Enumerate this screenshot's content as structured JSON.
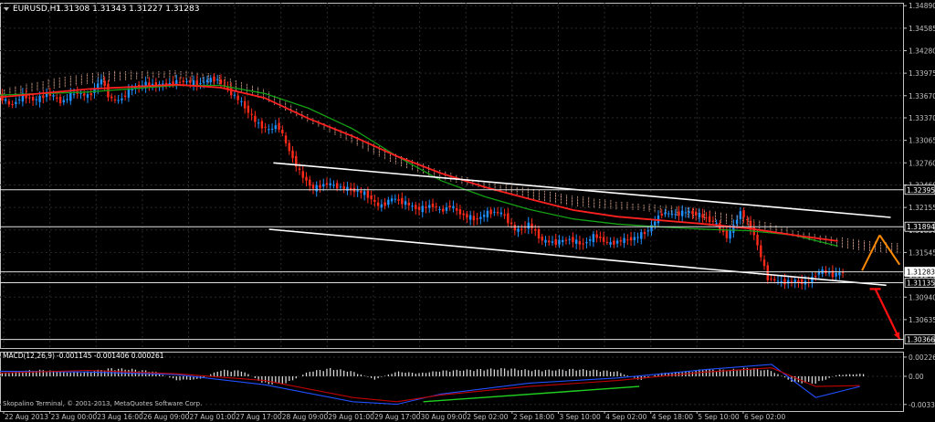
{
  "chart_data": [
    {
      "type": "candlestick",
      "title": "EURUSD,H1  1.31308 1.31343 1.31227 1.31283",
      "symbol_label": "EURUSD,H1",
      "ohlc_label": "1.31308 1.31343 1.31227 1.31283",
      "ohlc": {
        "open": 1.31308,
        "high": 1.31343,
        "low": 1.31227,
        "close": 1.31283
      },
      "ylim": [
        1.3025,
        1.3493
      ],
      "y_ticks": [
        1.3489,
        1.34585,
        1.3428,
        1.33975,
        1.3367,
        1.3337,
        1.33065,
        1.3276,
        1.3246,
        1.32155,
        1.3185,
        1.31545,
        1.3124,
        1.3094,
        1.30635
      ],
      "y_tick_labels": [
        "1.34890",
        "1.34585",
        "1.34280",
        "1.33975",
        "1.33670",
        "1.33370",
        "1.33065",
        "1.32760",
        "1.32460",
        "1.32155",
        "1.31850",
        "1.31545",
        "1.31240",
        "1.30940",
        "1.30635"
      ],
      "x_tick_labels": [
        "22 Aug 2013",
        "23 Aug 00:00",
        "23 Aug 16:00",
        "26 Aug 09:00",
        "27 Aug 01:00",
        "27 Aug 17:00",
        "28 Aug 09:00",
        "29 Aug 01:00",
        "29 Aug 17:00",
        "30 Aug 09:00",
        "2 Sep 02:00",
        "2 Sep 18:00",
        "3 Sep 10:00",
        "4 Sep 02:00",
        "4 Sep 18:00",
        "5 Sep 10:00",
        "6 Sep 02:00"
      ],
      "price_levels": [
        {
          "value": 1.32395,
          "label": "1.32395"
        },
        {
          "value": 1.31894,
          "label": "1.31894"
        },
        {
          "value": 1.31283,
          "label": "1.31283"
        },
        {
          "value": 1.31135,
          "label": "1.31135"
        },
        {
          "value": 1.30366,
          "label": "1.30366"
        }
      ],
      "grid": true,
      "series": [
        {
          "role": "close",
          "x": [
            0,
            5,
            10,
            16,
            22,
            28,
            34,
            40,
            46,
            50,
            54,
            60,
            66,
            72,
            78,
            84,
            90,
            94,
            98,
            104,
            110,
            116,
            122,
            126,
            130,
            136,
            142,
            148,
            154,
            160,
            166,
            172,
            178,
            184,
            190,
            196,
            200,
            204,
            210,
            216,
            222,
            228,
            234,
            240,
            246,
            252,
            258,
            264,
            270,
            276,
            282,
            288,
            294,
            300,
            306,
            312,
            318,
            324,
            330,
            336,
            342,
            348,
            354,
            360,
            366,
            372,
            378,
            383
          ],
          "values": [
            1.3366,
            1.3353,
            1.3367,
            1.3361,
            1.337,
            1.3358,
            1.3372,
            1.3366,
            1.3389,
            1.3362,
            1.336,
            1.3378,
            1.3383,
            1.3381,
            1.3384,
            1.3387,
            1.3383,
            1.3388,
            1.339,
            1.3373,
            1.3356,
            1.3331,
            1.332,
            1.3328,
            1.33,
            1.3262,
            1.3241,
            1.3248,
            1.3243,
            1.3239,
            1.3234,
            1.3216,
            1.3228,
            1.3221,
            1.3213,
            1.3219,
            1.321,
            1.3218,
            1.3205,
            1.3199,
            1.321,
            1.3207,
            1.3183,
            1.3193,
            1.317,
            1.3168,
            1.3173,
            1.3165,
            1.3178,
            1.3166,
            1.3171,
            1.3174,
            1.3185,
            1.3208,
            1.3206,
            1.321,
            1.3204,
            1.3195,
            1.3175,
            1.3211,
            1.3179,
            1.312,
            1.3114,
            1.3116,
            1.3113,
            1.313,
            1.3124,
            1.31283
          ]
        },
        {
          "role": "ma-red",
          "x": [
            0,
            40,
            80,
            100,
            120,
            140,
            160,
            180,
            200,
            220,
            240,
            260,
            280,
            300,
            320,
            340,
            360,
            380
          ],
          "values": [
            1.3365,
            1.3376,
            1.3382,
            1.3378,
            1.3364,
            1.3336,
            1.3312,
            1.3285,
            1.3262,
            1.3243,
            1.3227,
            1.3212,
            1.3203,
            1.3198,
            1.3193,
            1.3187,
            1.3178,
            1.317
          ]
        },
        {
          "role": "ma-green",
          "x": [
            0,
            40,
            80,
            100,
            120,
            140,
            160,
            180,
            200,
            220,
            240,
            260,
            280,
            300,
            320,
            340,
            360,
            380
          ],
          "values": [
            1.3368,
            1.3372,
            1.3381,
            1.3381,
            1.337,
            1.335,
            1.3322,
            1.3285,
            1.3252,
            1.323,
            1.3213,
            1.32,
            1.3193,
            1.3189,
            1.3186,
            1.3184,
            1.3178,
            1.3163
          ]
        },
        {
          "role": "channel-upper",
          "x": [
            124,
            404
          ],
          "values": [
            1.3276,
            1.3202
          ]
        },
        {
          "role": "channel-lower",
          "x": [
            122,
            402
          ],
          "values": [
            1.3186,
            1.311
          ]
        },
        {
          "role": "forecast-up",
          "x": [
            391,
            399
          ],
          "values": [
            1.313,
            1.3178
          ]
        },
        {
          "role": "forecast-down",
          "x": [
            399,
            408
          ],
          "values": [
            1.3178,
            1.3138
          ]
        },
        {
          "role": "forecast-target",
          "x": [
            397,
            408
          ],
          "values": [
            1.3105,
            1.3037
          ]
        }
      ]
    },
    {
      "type": "histogram",
      "title": "MACD(12,26,9) -0.001145 -0.001406 0.000261",
      "indicator_label": "MACD(12,26,9)",
      "values_label": "-0.001145 -0.001406 0.000261",
      "ylim": [
        -0.0041,
        0.0028
      ],
      "y_ticks": [
        0.002267,
        0.0,
        -0.003322
      ],
      "y_tick_labels": [
        "0.002267",
        "0.00",
        "-0.003322"
      ],
      "grid": true,
      "series": [
        {
          "role": "histogram",
          "x": [
            0,
            10,
            20,
            30,
            40,
            50,
            60,
            70,
            80,
            90,
            100,
            110,
            120,
            130,
            140,
            150,
            160,
            170,
            180,
            190,
            200,
            210,
            220,
            230,
            240,
            250,
            260,
            270,
            280,
            290,
            300,
            310,
            320,
            330,
            340,
            350,
            360,
            370,
            380,
            390
          ],
          "values": [
            0.0004,
            0.0007,
            0.0008,
            0.0005,
            0.0006,
            0.001,
            0.0009,
            0.0006,
            -0.0005,
            -0.0004,
            0.0008,
            0.0007,
            -0.001,
            -0.0009,
            0.0006,
            0.001,
            0.0006,
            -0.0004,
            0.0006,
            0.0004,
            0.0007,
            0.0008,
            0.0009,
            0.001,
            0.0008,
            0.0008,
            0.0009,
            0.0008,
            0.0006,
            -0.0005,
            0.0004,
            0.0006,
            0.0009,
            0.0008,
            0.0011,
            0.0007,
            -0.0008,
            -0.0009,
            0.0002,
            0.0003
          ]
        },
        {
          "role": "signal-red",
          "x": [
            0,
            40,
            80,
            120,
            160,
            180,
            200,
            240,
            280,
            320,
            350,
            370,
            390
          ],
          "values": [
            0.0004,
            0.0007,
            0.0003,
            -0.0005,
            -0.0025,
            -0.003,
            -0.0022,
            -0.0012,
            -0.0005,
            0.0005,
            0.001,
            -0.0012,
            -0.0011
          ]
        },
        {
          "role": "line-blue",
          "x": [
            0,
            40,
            80,
            120,
            160,
            180,
            200,
            240,
            280,
            320,
            350,
            370,
            390
          ],
          "values": [
            0.0006,
            0.0005,
            0.0002,
            -0.001,
            -0.003,
            -0.0033,
            -0.0021,
            -0.0008,
            -0.0002,
            0.0008,
            0.0014,
            -0.0025,
            -0.0012
          ]
        },
        {
          "role": "trend-green",
          "x": [
            192,
            290
          ],
          "values": [
            -0.003,
            -0.0012
          ]
        }
      ],
      "copyright": "Skopalino Terminal, © 2001-2013, MetaQuotes Software Corp."
    }
  ],
  "colors": {
    "background": "#000000",
    "grid": "#2a2a2a",
    "axis": "#c0c0c0",
    "text": "#c0c0c0",
    "candle_up": "#1e90ff",
    "candle_down": "#ff2a1a",
    "ma_red": "#ff2020",
    "ma_green": "#14a014",
    "cloud_dots": "#e8b098",
    "channel": "#ffffff",
    "forecast_orange": "#ff8c00",
    "forecast_red": "#ff1010",
    "level_box": "#ffffff",
    "macd_hist": "#d8d8d8",
    "macd_signal": "#c00000",
    "macd_line": "#2050ff"
  }
}
